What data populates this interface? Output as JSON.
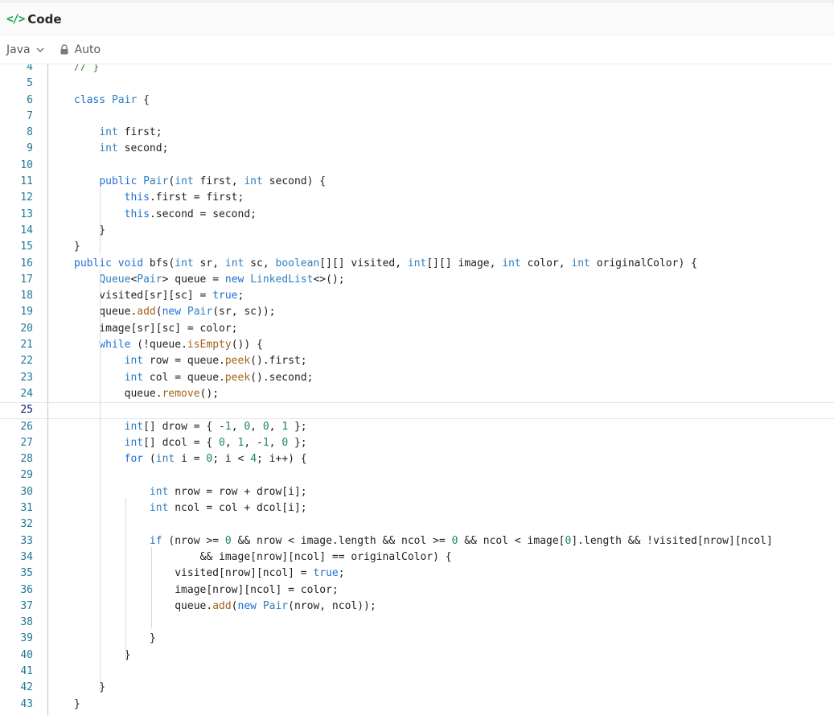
{
  "header": {
    "icon": "code-icon",
    "title": "Code"
  },
  "toolbar": {
    "language": "Java",
    "mode": "Auto"
  },
  "editor": {
    "active_line": 25,
    "lines": [
      {
        "n": "4",
        "code": "    // }"
      },
      {
        "n": "5",
        "code": ""
      },
      {
        "n": "6",
        "code": "    class Pair {"
      },
      {
        "n": "7",
        "code": ""
      },
      {
        "n": "8",
        "code": "        int first;"
      },
      {
        "n": "9",
        "code": "        int second;"
      },
      {
        "n": "10",
        "code": ""
      },
      {
        "n": "11",
        "code": "        public Pair(int first, int second) {"
      },
      {
        "n": "12",
        "code": "            this.first = first;"
      },
      {
        "n": "13",
        "code": "            this.second = second;"
      },
      {
        "n": "14",
        "code": "        }"
      },
      {
        "n": "15",
        "code": "    }"
      },
      {
        "n": "16",
        "code": "    public void bfs(int sr, int sc, boolean[][] visited, int[][] image, int color, int originalColor) {"
      },
      {
        "n": "17",
        "code": "        Queue<Pair> queue = new LinkedList<>();"
      },
      {
        "n": "18",
        "code": "        visited[sr][sc] = true;"
      },
      {
        "n": "19",
        "code": "        queue.add(new Pair(sr, sc));"
      },
      {
        "n": "20",
        "code": "        image[sr][sc] = color;"
      },
      {
        "n": "21",
        "code": "        while (!queue.isEmpty()) {"
      },
      {
        "n": "22",
        "code": "            int row = queue.peek().first;"
      },
      {
        "n": "23",
        "code": "            int col = queue.peek().second;"
      },
      {
        "n": "24",
        "code": "            queue.remove();"
      },
      {
        "n": "25",
        "code": ""
      },
      {
        "n": "26",
        "code": "            int[] drow = { -1, 0, 0, 1 };"
      },
      {
        "n": "27",
        "code": "            int[] dcol = { 0, 1, -1, 0 };"
      },
      {
        "n": "28",
        "code": "            for (int i = 0; i < 4; i++) {"
      },
      {
        "n": "29",
        "code": ""
      },
      {
        "n": "30",
        "code": "                int nrow = row + drow[i];"
      },
      {
        "n": "31",
        "code": "                int ncol = col + dcol[i];"
      },
      {
        "n": "32",
        "code": ""
      },
      {
        "n": "33",
        "code": "                if (nrow >= 0 && nrow < image.length && ncol >= 0 && ncol < image[0].length && !visited[nrow][ncol]"
      },
      {
        "n": "34",
        "code": "                        && image[nrow][ncol] == originalColor) {"
      },
      {
        "n": "35",
        "code": "                    visited[nrow][ncol] = true;"
      },
      {
        "n": "36",
        "code": "                    image[nrow][ncol] = color;"
      },
      {
        "n": "37",
        "code": "                    queue.add(new Pair(nrow, ncol));"
      },
      {
        "n": "38",
        "code": ""
      },
      {
        "n": "39",
        "code": "                }"
      },
      {
        "n": "40",
        "code": "            }"
      },
      {
        "n": "41",
        "code": ""
      },
      {
        "n": "42",
        "code": "        }"
      },
      {
        "n": "43",
        "code": "    }"
      }
    ]
  }
}
